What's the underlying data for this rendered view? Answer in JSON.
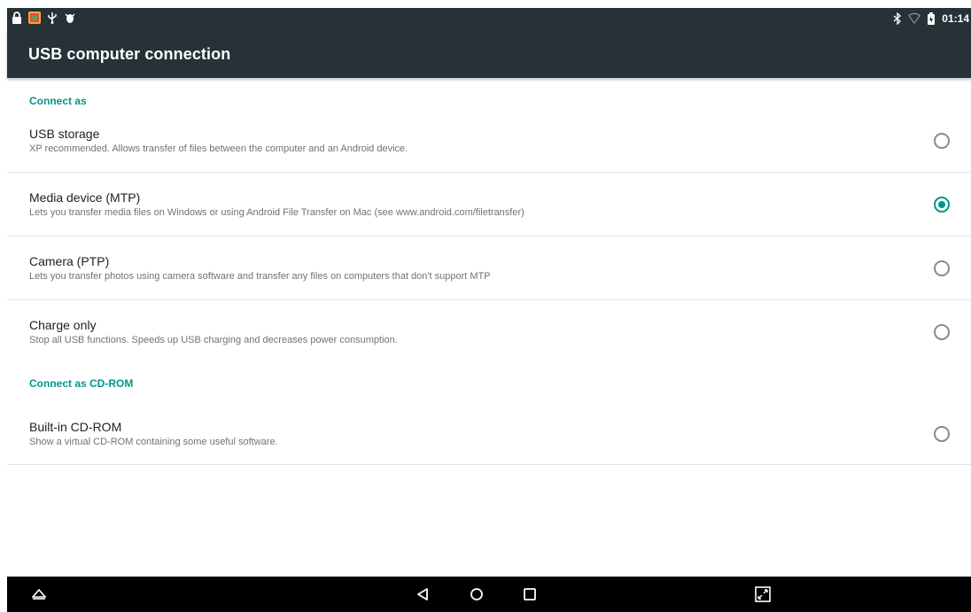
{
  "status_bar": {
    "left_icons": [
      "lock-icon",
      "gallery-icon",
      "usb-icon",
      "debug-icon"
    ],
    "right_icons": [
      "bluetooth-icon",
      "wifi-icon",
      "battery-icon"
    ],
    "time": "01:14"
  },
  "app_bar": {
    "title": "USB computer connection"
  },
  "sections": [
    {
      "header": "Connect as",
      "items": [
        {
          "title": "USB storage",
          "summary": "XP recommended. Allows transfer of files between the computer and an Android device.",
          "checked": false
        },
        {
          "title": "Media device (MTP)",
          "summary": "Lets you transfer media files on Windows or using Android File Transfer on Mac (see www.android.com/filetransfer)",
          "checked": true
        },
        {
          "title": "Camera (PTP)",
          "summary": "Lets you transfer photos using camera software and transfer any files on computers that don't support MTP",
          "checked": false
        },
        {
          "title": "Charge only",
          "summary": "Stop all USB functions. Speeds up USB charging and decreases power consumption.",
          "checked": false
        }
      ]
    },
    {
      "header": "Connect as CD-ROM",
      "items": [
        {
          "title": "Built-in CD-ROM",
          "summary": "Show a virtual CD-ROM containing some useful software.",
          "checked": false
        }
      ]
    }
  ],
  "nav_bar": {
    "buttons": [
      "hide-bar-icon",
      "back-icon",
      "home-icon",
      "recents-icon",
      "screenshot-icon"
    ]
  },
  "colors": {
    "toolbar": "#263238",
    "accent": "#009688",
    "nav_background": "#000000"
  }
}
